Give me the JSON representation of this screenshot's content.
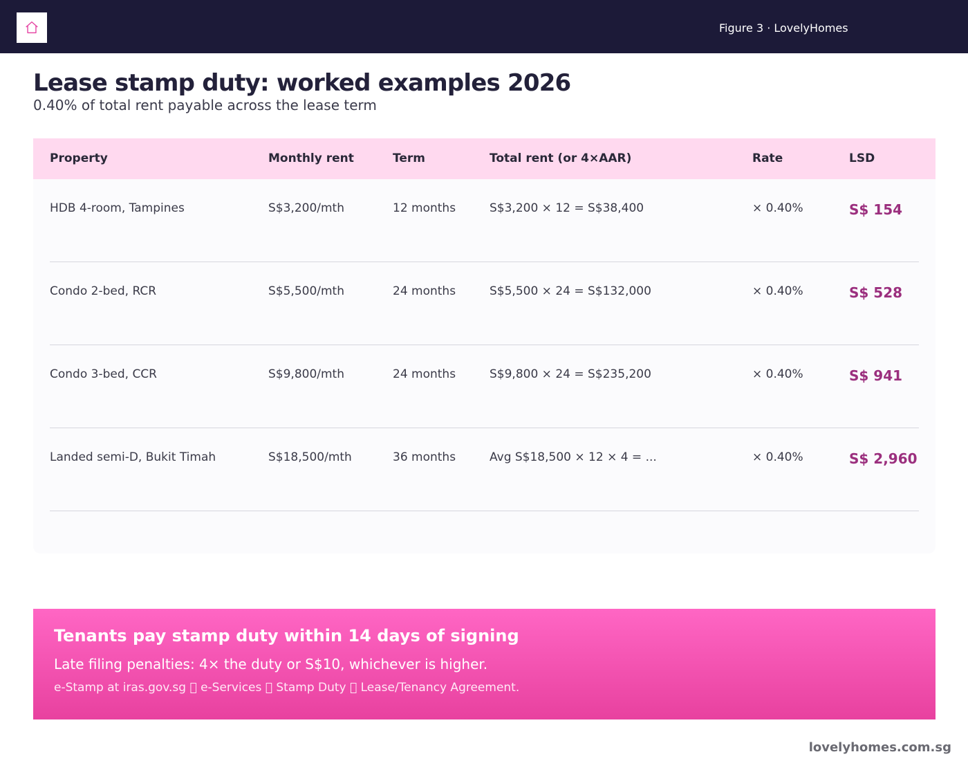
{
  "header": {
    "figure_label": "Figure 3 · LovelyHomes",
    "logo_icon": "house-icon"
  },
  "title": "Lease stamp duty: worked examples 2026",
  "subtitle": "0.40% of total rent payable across the lease term",
  "table": {
    "columns": [
      "Property",
      "Monthly rent",
      "Term",
      "Total rent (or 4×AAR)",
      "Rate",
      "LSD"
    ],
    "rows": [
      {
        "property": "HDB 4-room, Tampines",
        "monthly_rent": "S$3,200/mth",
        "term": "12 months",
        "total_rent": "S$3,200 × 12 = S$38,400",
        "rate": "× 0.40%",
        "lsd": "S$ 154"
      },
      {
        "property": "Condo 2-bed, RCR",
        "monthly_rent": "S$5,500/mth",
        "term": "24 months",
        "total_rent": "S$5,500 × 24 = S$132,000",
        "rate": "× 0.40%",
        "lsd": "S$ 528"
      },
      {
        "property": "Condo 3-bed, CCR",
        "monthly_rent": "S$9,800/mth",
        "term": "24 months",
        "total_rent": "S$9,800 × 24 = S$235,200",
        "rate": "× 0.40%",
        "lsd": "S$ 941"
      },
      {
        "property": "Landed semi-D, Bukit Timah",
        "monthly_rent": "S$18,500/mth",
        "term": "36 months",
        "total_rent": "Avg S$18,500 × 12 × 4 = ...",
        "rate": "× 0.40%",
        "lsd": "S$ 2,960"
      }
    ]
  },
  "callout": {
    "title": "Tenants pay stamp duty within 14 days of signing",
    "line1": "Late filing penalties: 4× the duty or S$10, whichever is higher.",
    "line2": "e-Stamp at iras.gov.sg ￿ e-Services ￿ Stamp Duty ￿ Lease/Tenancy Agreement."
  },
  "footer": "lovelyhomes.com.sg",
  "colors": {
    "topbar": "#1c1a38",
    "header_row": "#ffd9ef",
    "accent": "#9b2f7e",
    "callout_top": "#ff66c4",
    "callout_bottom": "#e8419f"
  }
}
